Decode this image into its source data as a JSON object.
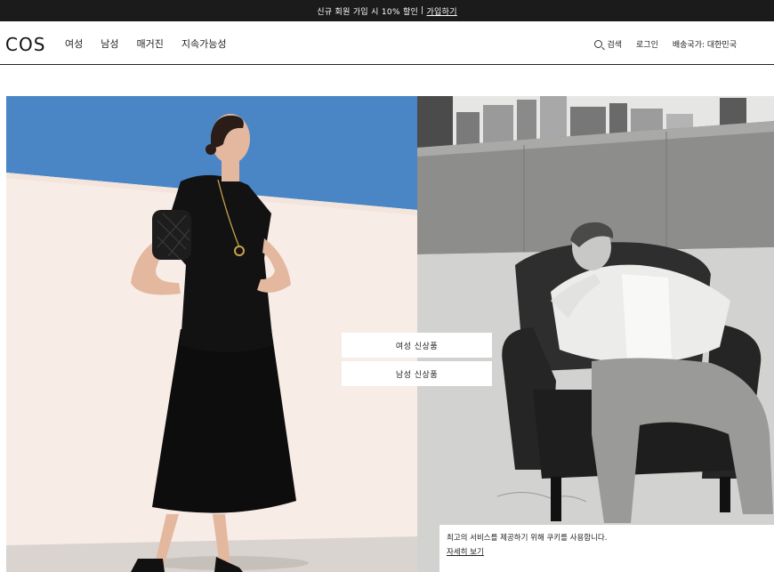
{
  "promo": {
    "text": "신규 회원 가입 시 10% 할인",
    "separator": "|",
    "link": "가입하기"
  },
  "header": {
    "logo": "COS",
    "nav": [
      "여성",
      "남성",
      "매거진",
      "지속가능성"
    ],
    "search_label": "검색",
    "login_label": "로그인",
    "shipping_label": "배송국가: 대한민국"
  },
  "hero": {
    "cta_women": "여성 신상품",
    "cta_men": "남성 신상품"
  },
  "cookie": {
    "message": "최고의 서비스를 제공하기 위해 쿠키를 사용합니다.",
    "link": "자세히 보기"
  },
  "colors": {
    "promo_bg": "#1b1b1b",
    "sky": "#4a86c6",
    "wall": "#f7ece6"
  }
}
